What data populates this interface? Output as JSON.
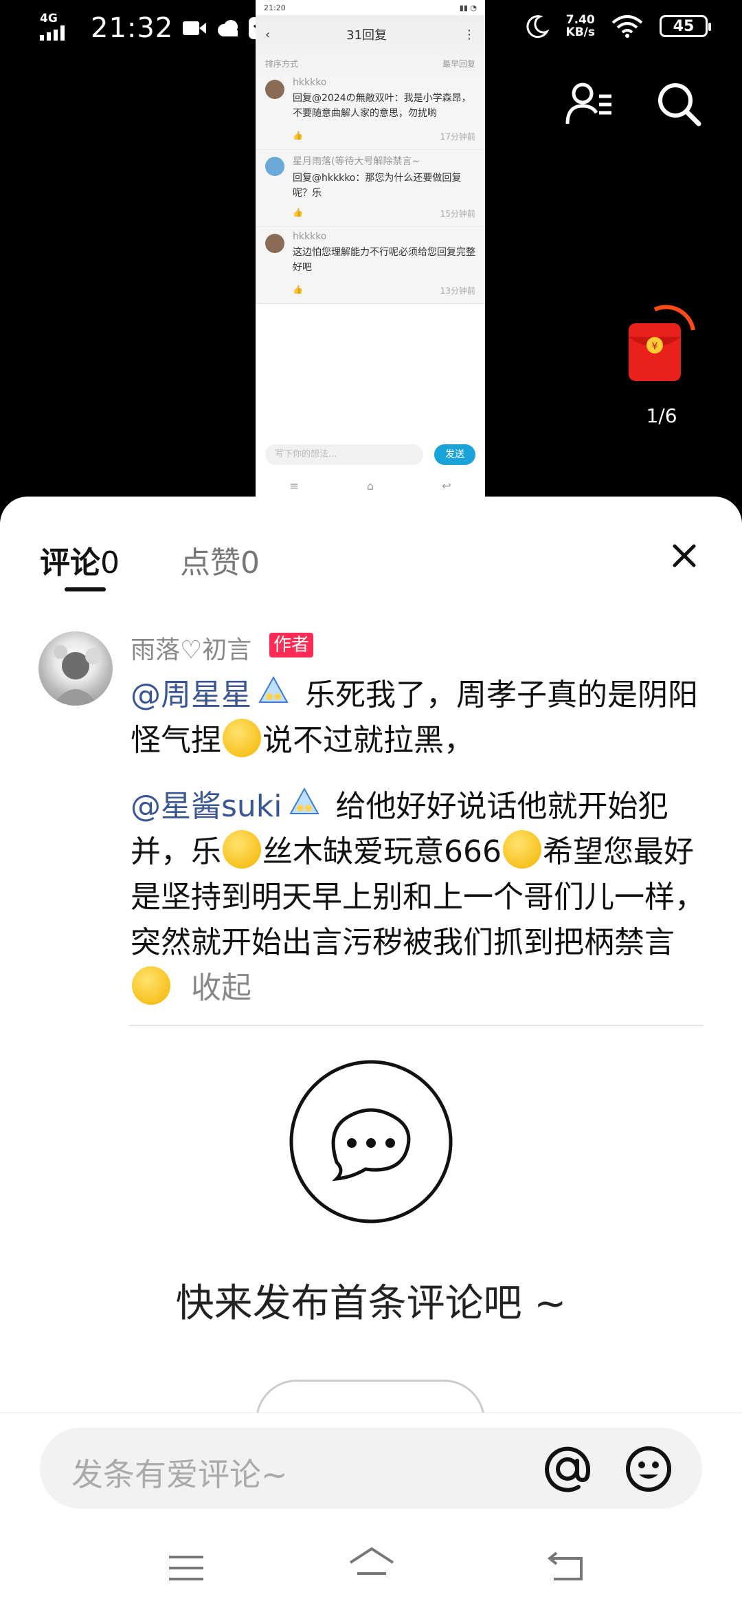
{
  "status_bar": {
    "network": "4G",
    "time": "21:32",
    "speed_value": "7.40",
    "speed_unit": "KB/s",
    "battery": "45"
  },
  "inner_screenshot": {
    "status_time": "21:20",
    "title": "31回复",
    "sort_label": "排序方式",
    "sort_value": "最早回复",
    "replies": [
      {
        "name": "hkkkko",
        "text": "回复@2024の無敵双叶：我是小学森昂，不要随意曲解人家的意思，勿扰喲",
        "time": "17分钟前"
      },
      {
        "name": "星月雨落(等待大号解除禁言~",
        "text": "回复@hkkkko：那您为什么还要做回复呢？乐",
        "time": "15分钟前"
      },
      {
        "name": "hkkkko",
        "text": "这边怕您理解能力不行呢必须给您回复完整好吧",
        "time": "13分钟前"
      }
    ],
    "input_placeholder": "写下你的想法...",
    "send_label": "发送"
  },
  "red_packet": {
    "count": "1/6"
  },
  "sheet": {
    "tab_comments": "评论",
    "tab_comments_count": "0",
    "tab_likes": "点赞",
    "tab_likes_count": "0",
    "author_name": "雨落♡初言",
    "author_badge": "作者",
    "comment": {
      "mention1": "@周星星",
      "part1": " 乐死我了，周孝子真的是阴阳怪气捏",
      "part2": "说不过就拉黑，",
      "mention2": "@星酱suki",
      "part3": " 给他好好说话他就开始犯并，乐",
      "part4": "丝木缺爱玩意666",
      "part5": "希望您最好是坚持到明天早上别和上一个哥们儿一样，突然就开始出言污秽被我们抓到把柄禁言",
      "collapse": "收起"
    },
    "empty_text": "快来发布首条评论吧 ~",
    "input_placeholder": "发条有爱评论~"
  }
}
